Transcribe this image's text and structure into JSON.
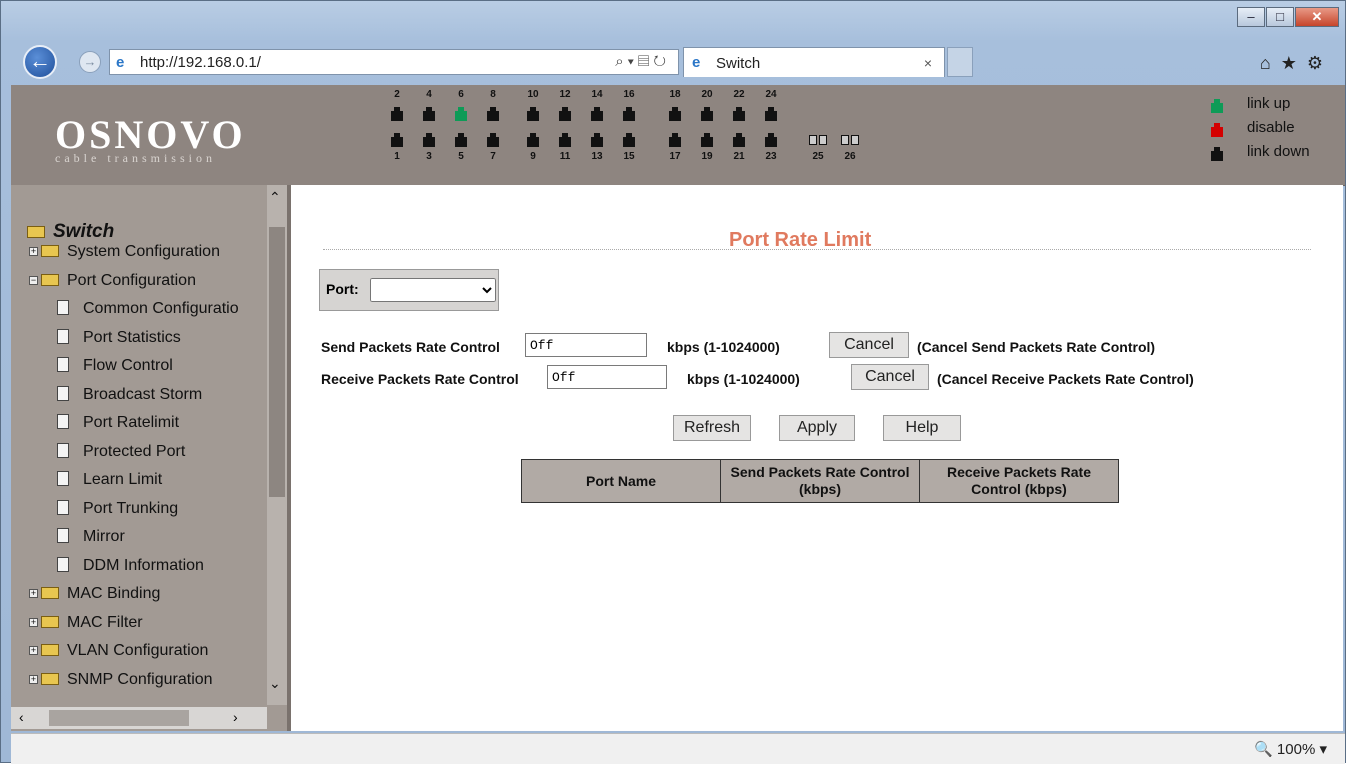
{
  "browser": {
    "url": "http://192.168.0.1/",
    "tab_title": "Switch",
    "tab_close": "×",
    "zoom": "100%"
  },
  "banner": {
    "logo": "OSNOVO",
    "logo_sub": "cable transmission",
    "top_port_labels": [
      "2",
      "4",
      "6",
      "8",
      "10",
      "12",
      "14",
      "16",
      "18",
      "20",
      "22",
      "24"
    ],
    "bottom_port_labels": [
      "1",
      "3",
      "5",
      "7",
      "9",
      "11",
      "13",
      "15",
      "17",
      "19",
      "21",
      "23",
      "25",
      "26"
    ],
    "legend": [
      "link up",
      "disable",
      "link down"
    ]
  },
  "sidebar": {
    "root": "Switch",
    "items": [
      {
        "label": "System Configuration",
        "type": "folder",
        "expanded": false
      },
      {
        "label": "Port Configuration",
        "type": "folder",
        "expanded": true
      },
      {
        "label": "Common Configuratio",
        "type": "page"
      },
      {
        "label": "Port Statistics",
        "type": "page"
      },
      {
        "label": "Flow Control",
        "type": "page"
      },
      {
        "label": "Broadcast Storm",
        "type": "page"
      },
      {
        "label": "Port Ratelimit",
        "type": "page"
      },
      {
        "label": "Protected Port",
        "type": "page"
      },
      {
        "label": "Learn Limit",
        "type": "page"
      },
      {
        "label": "Port Trunking",
        "type": "page"
      },
      {
        "label": "Mirror",
        "type": "page"
      },
      {
        "label": "DDM Information",
        "type": "page"
      },
      {
        "label": "MAC Binding",
        "type": "folder",
        "expanded": false
      },
      {
        "label": "MAC Filter",
        "type": "folder",
        "expanded": false
      },
      {
        "label": "VLAN Configuration",
        "type": "folder",
        "expanded": false
      },
      {
        "label": "SNMP Configuration",
        "type": "folder",
        "expanded": false
      }
    ]
  },
  "main": {
    "title": "Port Rate Limit",
    "port_label": "Port:",
    "port_value": "",
    "send_label": "Send Packets Rate Control",
    "send_value": "Off",
    "send_units": "kbps (1-1024000)",
    "send_cancel": "Cancel",
    "send_cancel_desc": "(Cancel Send Packets Rate Control)",
    "recv_label": "Receive Packets Rate Control",
    "recv_value": "Off",
    "recv_units": "kbps (1-1024000)",
    "recv_cancel": "Cancel",
    "recv_cancel_desc": "(Cancel Receive Packets Rate Control)",
    "refresh": "Refresh",
    "apply": "Apply",
    "help": "Help",
    "table_headers": [
      "Port Name",
      "Send Packets Rate Control (kbps)",
      "Receive Packets Rate Control (kbps)"
    ]
  },
  "colors": {
    "banner": "#8e8580",
    "sidebar": "#a29a94",
    "title": "#e07a5f",
    "link_up": "#0e9b57",
    "disable": "#d40000",
    "link_down": "#111111"
  }
}
